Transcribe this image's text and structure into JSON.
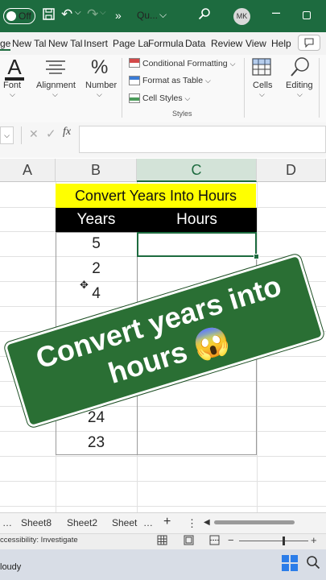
{
  "titlebar": {
    "autosave": "Off",
    "more": "»",
    "title": "Qu...",
    "dropdown": "⌵",
    "avatar": "MK"
  },
  "tabs": [
    "ge",
    "New Tal",
    "New Tal",
    "Insert",
    "Page La",
    "Formula",
    "Data",
    "Review",
    "View",
    "Help"
  ],
  "ribbon": {
    "font": "Font",
    "alignment": "Alignment",
    "number": "Number",
    "conditional_formatting": "Conditional Formatting",
    "format_as_table": "Format as Table",
    "cell_styles": "Cell Styles",
    "styles_group": "Styles",
    "cells": "Cells",
    "editing": "Editing",
    "number_symbol": "%",
    "font_symbol": "A"
  },
  "formula_bar": {
    "cancel": "✕",
    "enter": "✓",
    "fx": "fx",
    "value": ""
  },
  "columns": [
    "A",
    "B",
    "C",
    "D"
  ],
  "table": {
    "title": "Convert Years Into Hours",
    "headers": [
      "Years",
      "Hours"
    ],
    "years": [
      "5",
      "2",
      "4",
      "",
      "",
      "2",
      "24",
      "23"
    ]
  },
  "banner": {
    "line1": "Convert years into",
    "line2": "hours 😱"
  },
  "sheet_tabs": [
    "Sheet8",
    "Sheet2",
    "Sheet"
  ],
  "sheet_controls": {
    "more": "…",
    "add": "+",
    "menu": "⋮"
  },
  "status": {
    "accessibility": "ccessibility: Investigate"
  },
  "taskbar": {
    "weather": "loudy"
  }
}
